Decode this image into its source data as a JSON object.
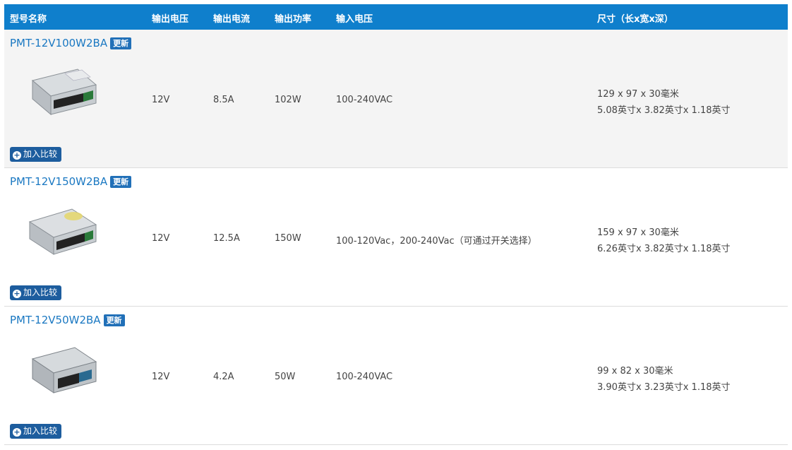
{
  "header": {
    "model": "型号名称",
    "vout": "输出电压",
    "iout": "输出电流",
    "power": "输出功率",
    "vin": "输入电压",
    "size": "尺寸（长x宽x深）"
  },
  "badge_label": "更新",
  "compare_label": "加入比较",
  "compare_icon": "plus-circle-icon",
  "colors": {
    "header_bg": "#0f7fcc",
    "link": "#1a78c2",
    "badge_bg": "#2170b8",
    "compare_bg": "#1d5d9e",
    "row_shade": "#f4f4f4"
  },
  "rows": [
    {
      "model": "PMT-12V100W2BA",
      "vout": "12V",
      "iout": "8.5A",
      "power": "102W",
      "vin": "100-240VAC",
      "size_mm": "129 x 97 x 30毫米",
      "size_in": "5.08英寸x 3.82英寸x 1.18英寸"
    },
    {
      "model": "PMT-12V150W2BA",
      "vout": "12V",
      "iout": "12.5A",
      "power": "150W",
      "vin": "100-120Vac，200-240Vac（可通过开关选择）",
      "size_mm": "159 x 97 x 30毫米",
      "size_in": "6.26英寸x 3.82英寸x 1.18英寸"
    },
    {
      "model": "PMT-12V50W2BA",
      "vout": "12V",
      "iout": "4.2A",
      "power": "50W",
      "vin": "100-240VAC",
      "size_mm": "99 x 82 x 30毫米",
      "size_in": "3.90英寸x 3.23英寸x 1.18英寸"
    }
  ]
}
